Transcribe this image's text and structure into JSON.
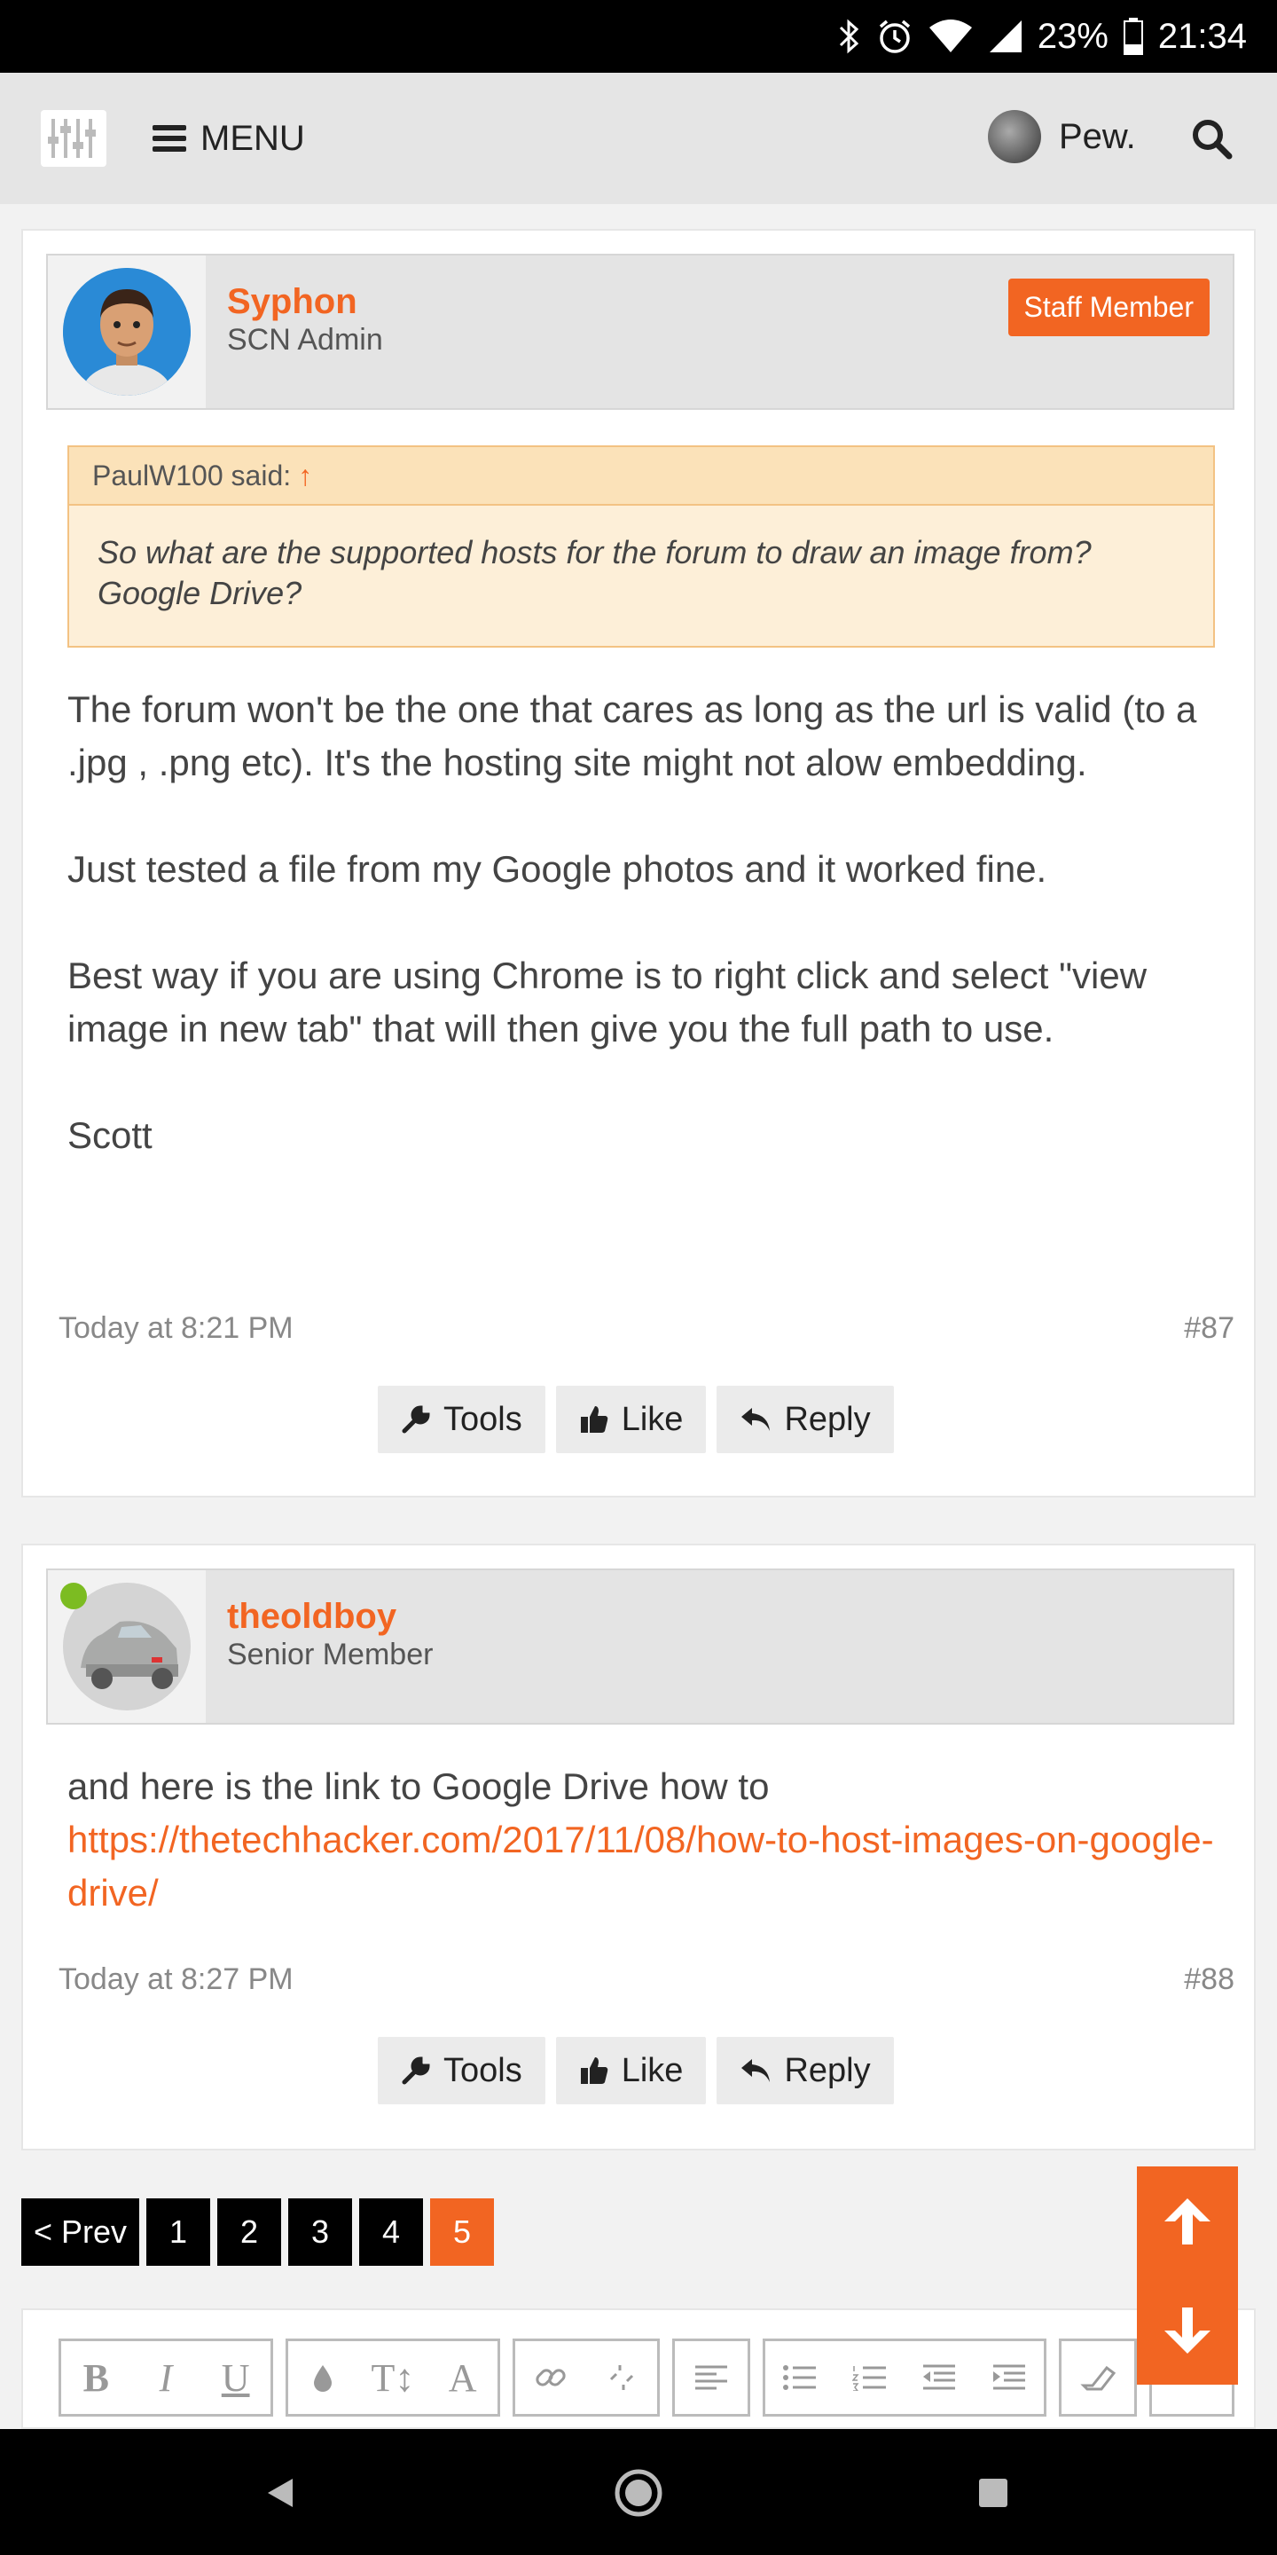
{
  "status": {
    "battery": "23%",
    "time": "21:34"
  },
  "nav": {
    "menu_label": "MENU",
    "username": "Pew."
  },
  "posts": [
    {
      "username": "Syphon",
      "title": "SCN Admin",
      "badge": "Staff Member",
      "quote": {
        "author": "PaulW100 said:",
        "arrow": "↑",
        "text": "So what are the supported hosts for the forum to draw an image from? Google Drive?"
      },
      "paragraphs": [
        "The forum won't be the one that cares as long as the url is valid (to a .jpg , .png etc). It's the hosting site might not alow embedding.",
        "Just tested a file from my Google photos and it worked fine.",
        "Best way if you are using Chrome is to right click and select \"view image in new tab\" that will then give you the full path to use.",
        "Scott"
      ],
      "date": "Today at 8:21 PM",
      "number": "#87"
    },
    {
      "username": "theoldboy",
      "title": "Senior Member",
      "text": "and here is the link to Google Drive how to",
      "link": "https://thetechhacker.com/2017/11/08/how-to-host-images-on-google-drive/",
      "date": "Today at 8:27 PM",
      "number": "#88"
    }
  ],
  "actions": {
    "tools": "Tools",
    "like": "Like",
    "reply": "Reply"
  },
  "pagination": {
    "prev": "< Prev",
    "pages": [
      "1",
      "2",
      "3",
      "4",
      "5"
    ],
    "current": "5"
  },
  "editor": {
    "bold": "B",
    "italic": "I",
    "underline": "U",
    "size": "T↕",
    "font": "A"
  },
  "colors": {
    "accent": "#f26522",
    "online": "#7cbc22",
    "quote_bg": "#fdefd8"
  }
}
